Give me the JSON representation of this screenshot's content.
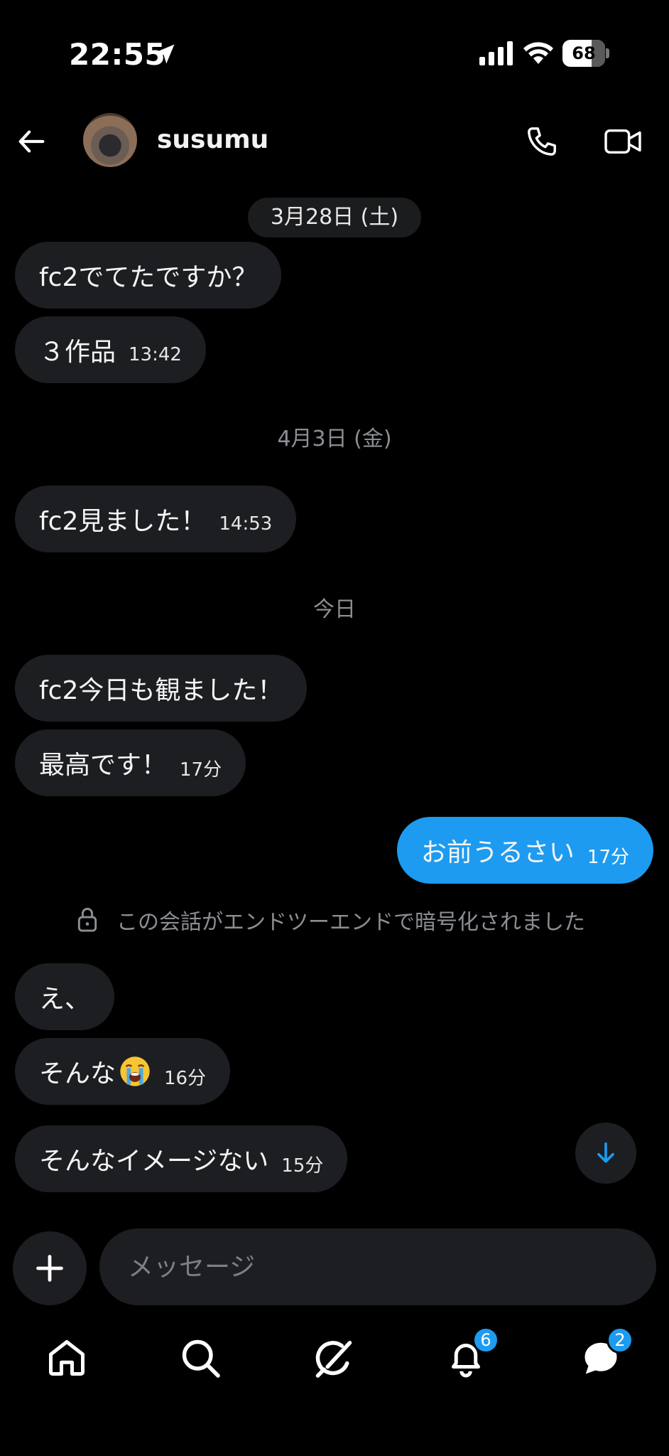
{
  "status_bar": {
    "time": "22:55",
    "battery": "68",
    "battery_level": 0.68
  },
  "header": {
    "contact_name": "susumu"
  },
  "dates": {
    "first": "3月28日 (土)",
    "second": "4月3日 (金)",
    "third": "今日"
  },
  "messages": [
    {
      "text": "fc2でてたですか？",
      "time": "",
      "direction": "incoming"
    },
    {
      "text": "３作品",
      "time": "13:42",
      "direction": "incoming"
    },
    {
      "text": "fc2見ました！",
      "time": "14:53",
      "direction": "incoming"
    },
    {
      "text": "fc2今日も観ました！",
      "time": "",
      "direction": "incoming"
    },
    {
      "text": "最高です！",
      "time": "17分",
      "direction": "incoming"
    },
    {
      "text": "お前うるさい",
      "time": "17分",
      "direction": "outgoing"
    },
    {
      "text": "え、",
      "time": "",
      "direction": "incoming"
    },
    {
      "text": "そんな",
      "emoji": "😭",
      "time": "16分",
      "direction": "incoming"
    },
    {
      "text": "そんなイメージない",
      "time": "15分",
      "direction": "incoming"
    }
  ],
  "encryption_notice": "この会話がエンドツーエンドで暗号化されました",
  "composer": {
    "placeholder": "メッセージ"
  },
  "tabbar": {
    "notifications_badge": "6",
    "messages_badge": "2",
    "icons": [
      "home-icon",
      "search-icon",
      "grok-icon",
      "bell-icon",
      "messages-icon"
    ]
  },
  "colors": {
    "accent": "#1d9bf0",
    "bubble": "#1d1e21",
    "background": "#000000"
  }
}
